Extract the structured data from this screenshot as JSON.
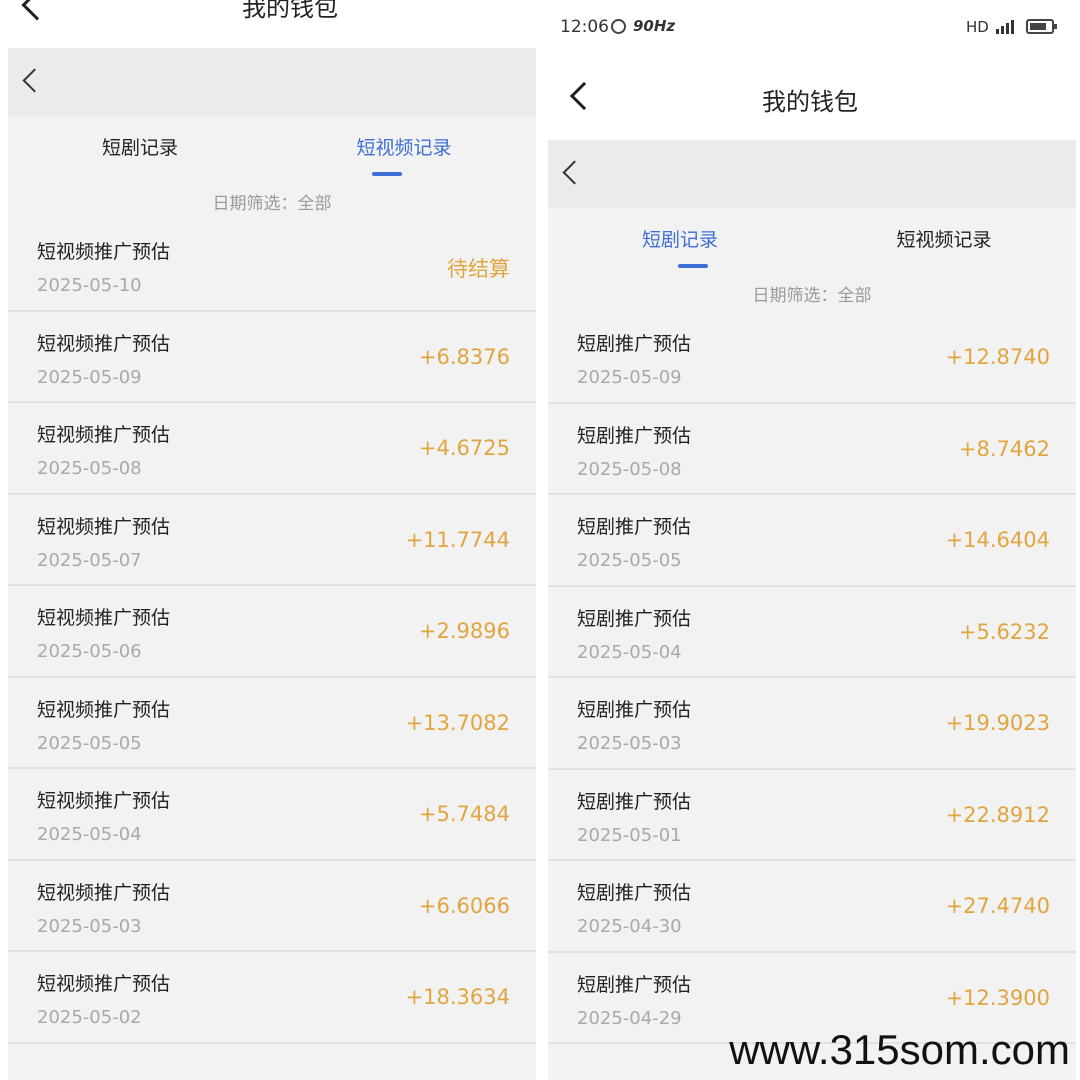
{
  "left": {
    "top_title": "我的钱包",
    "tabs": [
      {
        "label": "短剧记录",
        "active": false
      },
      {
        "label": "短视频记录",
        "active": true
      }
    ],
    "filter_label": "日期筛选：全部",
    "records": [
      {
        "title": "短视频推广预估",
        "date": "2025-05-10",
        "amount": "待结算"
      },
      {
        "title": "短视频推广预估",
        "date": "2025-05-09",
        "amount": "+6.8376"
      },
      {
        "title": "短视频推广预估",
        "date": "2025-05-08",
        "amount": "+4.6725"
      },
      {
        "title": "短视频推广预估",
        "date": "2025-05-07",
        "amount": "+11.7744"
      },
      {
        "title": "短视频推广预估",
        "date": "2025-05-06",
        "amount": "+2.9896"
      },
      {
        "title": "短视频推广预估",
        "date": "2025-05-05",
        "amount": "+13.7082"
      },
      {
        "title": "短视频推广预估",
        "date": "2025-05-04",
        "amount": "+5.7484"
      },
      {
        "title": "短视频推广预估",
        "date": "2025-05-03",
        "amount": "+6.6066"
      },
      {
        "title": "短视频推广预估",
        "date": "2025-05-02",
        "amount": "+18.3634"
      }
    ]
  },
  "right": {
    "status_bar": {
      "time": "12:06",
      "refresh_rate": "90Hz",
      "network": "HD"
    },
    "title": "我的钱包",
    "tabs": [
      {
        "label": "短剧记录",
        "active": true
      },
      {
        "label": "短视频记录",
        "active": false
      }
    ],
    "filter_label": "日期筛选：全部",
    "records": [
      {
        "title": "短剧推广预估",
        "date": "2025-05-09",
        "amount": "+12.8740"
      },
      {
        "title": "短剧推广预估",
        "date": "2025-05-08",
        "amount": "+8.7462"
      },
      {
        "title": "短剧推广预估",
        "date": "2025-05-05",
        "amount": "+14.6404"
      },
      {
        "title": "短剧推广预估",
        "date": "2025-05-04",
        "amount": "+5.6232"
      },
      {
        "title": "短剧推广预估",
        "date": "2025-05-03",
        "amount": "+19.9023"
      },
      {
        "title": "短剧推广预估",
        "date": "2025-05-01",
        "amount": "+22.8912"
      },
      {
        "title": "短剧推广预估",
        "date": "2025-04-30",
        "amount": "+27.4740"
      },
      {
        "title": "短剧推广预估",
        "date": "2025-04-29",
        "amount": "+12.3900"
      }
    ]
  },
  "watermark": "www.315som.com",
  "colors": {
    "accent": "#3f6fd6",
    "amount": "#e0a53f",
    "muted": "#a9a9a9"
  }
}
